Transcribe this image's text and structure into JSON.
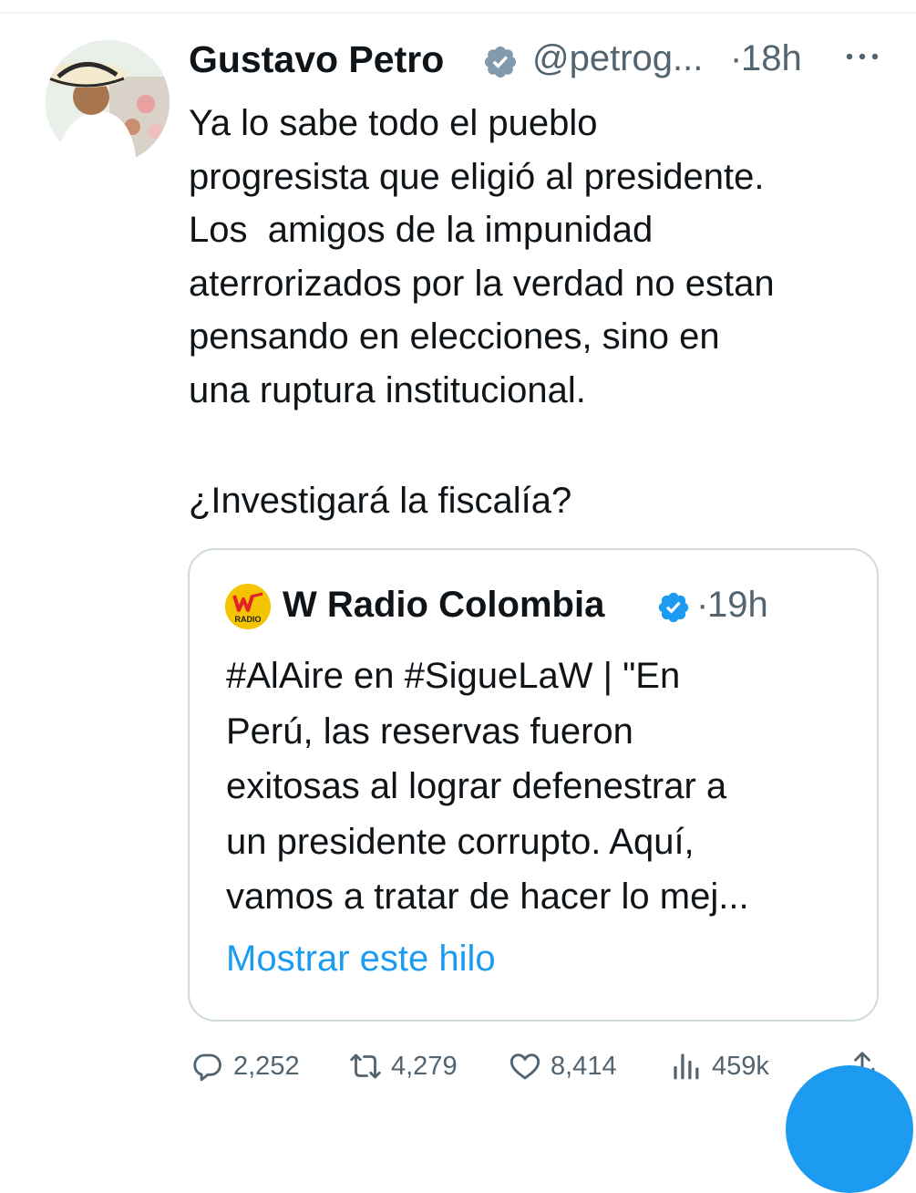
{
  "tweet": {
    "author_name": "Gustavo Petro",
    "author_handle": "@petrog...",
    "separator": "·",
    "timestamp": "18h",
    "verified": true,
    "text_lines": [
      "Ya lo sabe todo el pueblo",
      "progresista que eligió al presidente.",
      "Los  amigos de la impunidad",
      "aterrorizados por la verdad no estan",
      "pensando en elecciones, sino en",
      "una ruptura institucional."
    ],
    "question": "¿Investigará la fiscalía?"
  },
  "quote": {
    "author_name": "W Radio Colombia",
    "separator": "·",
    "timestamp": "19h",
    "verified": true,
    "logo_text": "RADIO",
    "text_lines": [
      "#AlAire en #SigueLaW | \"En",
      "Perú, las reservas fueron",
      "exitosas al lograr defenestrar a",
      "un presidente corrupto. Aquí,",
      "vamos a tratar de hacer lo mej..."
    ],
    "show_thread": "Mostrar este hilo"
  },
  "actions": {
    "replies": "2,252",
    "retweets": "4,279",
    "likes": "8,414",
    "views": "459k"
  },
  "colors": {
    "accent": "#1d9bf0",
    "muted": "#536471",
    "text": "#0f1419",
    "border": "#cfd9de",
    "logo_yellow": "#f5c400"
  },
  "icons": [
    "verified-badge-icon",
    "more-icon",
    "reply-icon",
    "retweet-icon",
    "like-icon",
    "views-icon",
    "share-icon"
  ]
}
